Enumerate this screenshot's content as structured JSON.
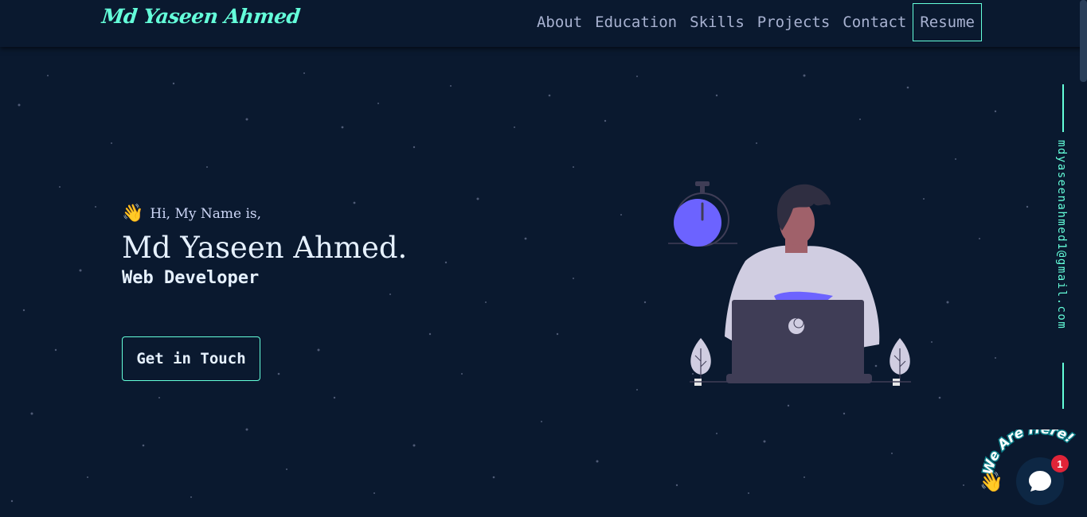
{
  "brand": {
    "logo_text": "Md Yaseen Ahmed"
  },
  "nav": {
    "items": [
      {
        "label": "About"
      },
      {
        "label": "Education"
      },
      {
        "label": "Skills"
      },
      {
        "label": "Projects"
      },
      {
        "label": "Contact"
      }
    ],
    "resume_label": "Resume"
  },
  "hero": {
    "greeting_icon": "waving-hand-icon",
    "greeting": "Hi, My Name is,",
    "name": "Md Yaseen Ahmed.",
    "role": "Web Developer",
    "cta_label": "Get in Touch"
  },
  "sidebar": {
    "email": "mdyaseenahmed1@gmail.com"
  },
  "chat": {
    "arc_text": "We Are Here!",
    "badge_count": "1",
    "icon": "chat-bubble-icon"
  },
  "colors": {
    "background": "#0a192f",
    "accent": "#64ffda",
    "nav_text": "#a8b2d1",
    "heading_text": "#e6f1ff",
    "illustration_purple": "#6c63ff",
    "badge_red": "#e02438"
  }
}
